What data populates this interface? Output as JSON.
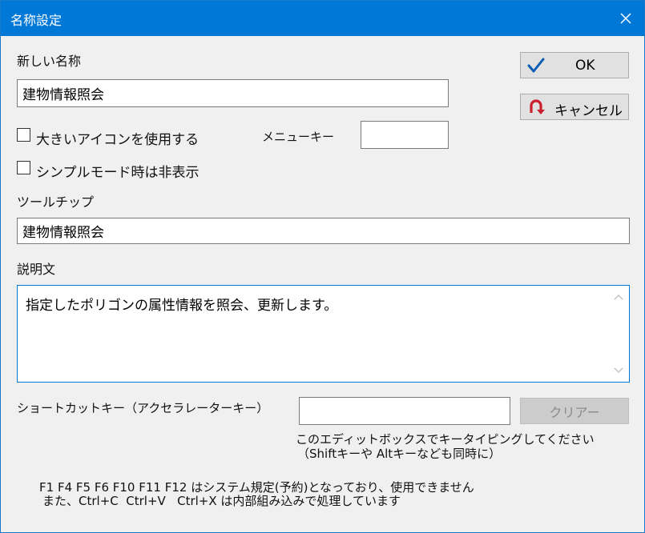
{
  "window": {
    "title": "名称設定"
  },
  "new_name": {
    "label": "新しい名称",
    "value": "建物情報照会"
  },
  "buttons": {
    "ok": "OK",
    "cancel": "キャンセル",
    "clear": "クリアー"
  },
  "options": {
    "large_icon": {
      "label": "大きいアイコンを使用する",
      "checked": false
    },
    "hide_in_simple": {
      "label": "シンプルモード時は非表示",
      "checked": false
    }
  },
  "menu_key": {
    "label": "メニューキー",
    "value": ""
  },
  "tooltip": {
    "label": "ツールチップ",
    "value": "建物情報照会"
  },
  "description": {
    "label": "説明文",
    "value": "指定したポリゴンの属性情報を照会、更新します。"
  },
  "shortcut": {
    "label": "ショートカットキー（アクセラレーターキー）",
    "value": "",
    "hint1": "このエディットボックスでキータイピングしてください",
    "hint2": "（Shiftキーや Altキーなども同時に）"
  },
  "notes": {
    "line1": "F1 F4 F5 F6 F10 F11 F12 はシステム規定(予約)となっており、使用できません",
    "line2": "また、Ctrl+C  Ctrl+V   Ctrl+X は内部組み込みで処理しています"
  },
  "colors": {
    "titlebar": "#0078d7",
    "ok_check": "#0a5fb4",
    "cancel_icon": "#cc1f2e"
  }
}
